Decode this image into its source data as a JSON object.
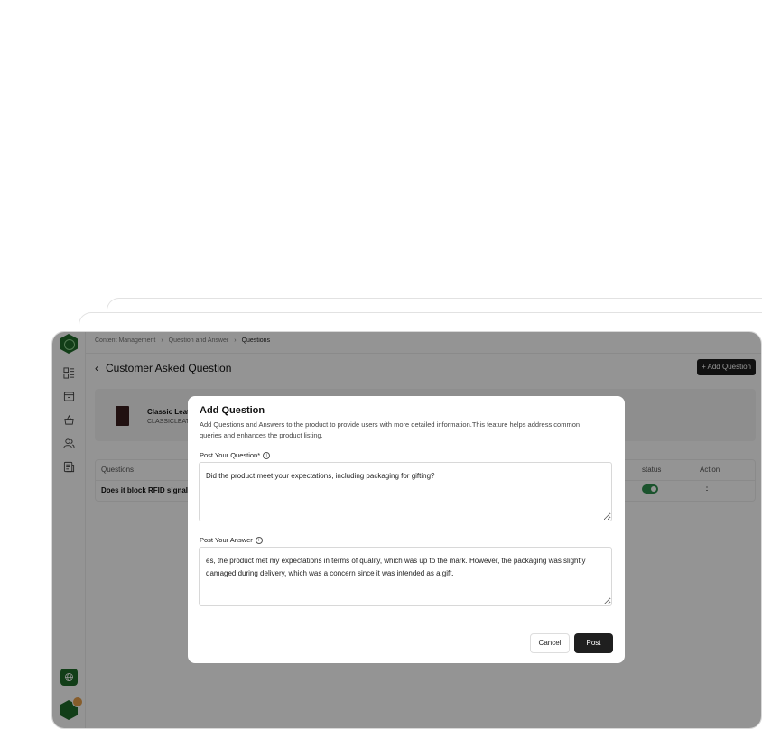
{
  "breadcrumb": [
    "Content Management",
    "Question and Answer",
    "Questions"
  ],
  "page": {
    "title": "Customer Asked Question",
    "add_button": "+ Add Question"
  },
  "product": {
    "name": "Classic Leat",
    "sku": "CLASSICLEAT"
  },
  "table": {
    "headers": {
      "questions": "Questions",
      "status": "status",
      "action": "Action"
    },
    "rows": [
      {
        "question": "Does it block RFID signals?"
      }
    ]
  },
  "modal": {
    "title": "Add Question",
    "description": "Add Questions and Answers to the product to provide users with more detailed information.This feature helps address common queries and enhances the product listing.",
    "question_label": "Post Your Question*",
    "question_value": "Did the product meet your expectations, including packaging for gifting?",
    "answer_label": "Post Your Answer",
    "answer_value": "es, the product met my expectations in terms of quality, which was up to the mark. However, the packaging was slightly damaged during delivery, which was a concern since it was intended as a gift.",
    "cancel_label": "Cancel",
    "post_label": "Post"
  },
  "colors": {
    "brand": "#1f6b2a",
    "primary_button": "#1f1f1f",
    "toggle_on": "#2f8f4f"
  }
}
